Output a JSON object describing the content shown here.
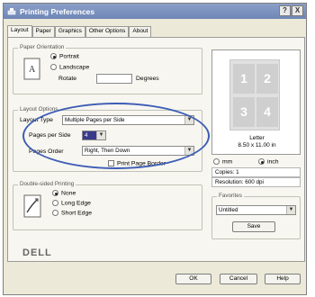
{
  "window": {
    "title": "Printing Preferences",
    "help_btn": "?",
    "close_btn": "X"
  },
  "tabs": [
    "Layout",
    "Paper",
    "Graphics",
    "Other Options",
    "About"
  ],
  "orientation": {
    "group_title": "Paper Orientation",
    "portrait": "Portrait",
    "landscape": "Landscape",
    "rotate_label": "Rotate",
    "rotate_unit": "Degrees"
  },
  "layout": {
    "group_title": "Layout Options",
    "layout_type_label": "Layout Type",
    "layout_type_value": "Multiple Pages per Side",
    "pages_per_side_label": "Pages per Side",
    "pages_per_side_value": "4",
    "pages_order_label": "Pages Order",
    "pages_order_value": "Right, Then Down",
    "print_border": "Print Page Border"
  },
  "duplex": {
    "group_title": "Double-sided Printing",
    "none": "None",
    "long": "Long Edge",
    "short": "Short Edge"
  },
  "preview": {
    "cells": [
      "1",
      "2",
      "3",
      "4"
    ],
    "paper_name": "Letter",
    "paper_size": "8.50 x 11.00 in",
    "unit_mm": "mm",
    "unit_inch": "inch",
    "copies": "Copies: 1",
    "resolution": "Resolution: 600 dpi"
  },
  "favorites": {
    "group_title": "Favorites",
    "value": "Untitled",
    "save": "Save"
  },
  "brand": "DELL",
  "footer": {
    "ok": "OK",
    "cancel": "Cancel",
    "help": "Help"
  },
  "colors": {
    "highlight_ellipse": "#3d5db6",
    "titlebar": "#6f86b6"
  }
}
